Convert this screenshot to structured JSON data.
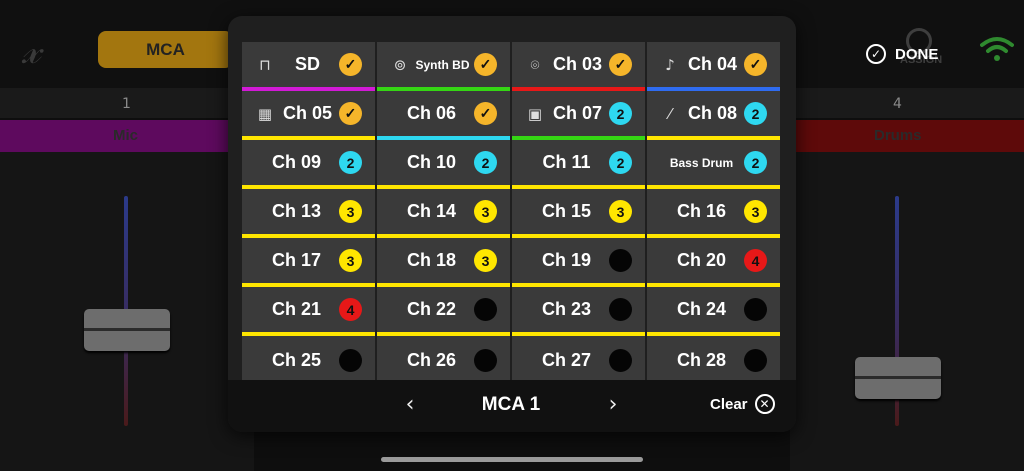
{
  "colors": {
    "yellow": "#ffe600",
    "orange": "#f5b52a",
    "cyan": "#2ed8f0",
    "red": "#e71818",
    "magenta": "#d21ad6",
    "green": "#35d614",
    "blue": "#2f6cf0",
    "empty": "#050505"
  },
  "header": {
    "app_logo": "x-logo",
    "mca_button_label": "MCA",
    "assign_label": "ASSIGN",
    "done_label": "DONE"
  },
  "mixer": {
    "strip_numbers": [
      "1",
      "4"
    ],
    "strip_names": [
      "Mic",
      "Drums"
    ]
  },
  "modal": {
    "title": "MCA 1",
    "prev_icon": "chevron-left-icon",
    "next_icon": "chevron-right-icon",
    "clear_label": "Clear",
    "channels": [
      {
        "label": "SD",
        "icon": "snare-icon",
        "badge": "check",
        "color": "orange",
        "underline": "magenta"
      },
      {
        "label": "Synth BD",
        "icon": "kick-drum-icon",
        "badge": "check",
        "color": "orange",
        "underline": "green"
      },
      {
        "label": "Ch 03",
        "icon": "cymbal-icon",
        "badge": "check",
        "color": "orange",
        "underline": "red"
      },
      {
        "label": "Ch 04",
        "icon": "guitar-icon",
        "badge": "check",
        "color": "orange",
        "underline": "blue"
      },
      {
        "label": "Ch 05",
        "icon": "keyboard-icon",
        "badge": "check",
        "color": "orange",
        "underline": "yellow"
      },
      {
        "label": "Ch 06",
        "icon": "",
        "badge": "check",
        "color": "orange",
        "underline": "cyan"
      },
      {
        "label": "Ch 07",
        "icon": "amp-icon",
        "badge": "2",
        "color": "cyan",
        "underline": "green"
      },
      {
        "label": "Ch 08",
        "icon": "electric-guitar-icon",
        "badge": "2",
        "color": "cyan",
        "underline": "yellow"
      },
      {
        "label": "Ch 09",
        "icon": "",
        "badge": "2",
        "color": "cyan",
        "underline": "yellow"
      },
      {
        "label": "Ch 10",
        "icon": "",
        "badge": "2",
        "color": "cyan",
        "underline": "yellow"
      },
      {
        "label": "Ch 11",
        "icon": "",
        "badge": "2",
        "color": "cyan",
        "underline": "yellow"
      },
      {
        "label": "Bass Drum",
        "icon": "",
        "badge": "2",
        "color": "cyan",
        "underline": "yellow"
      },
      {
        "label": "Ch 13",
        "icon": "",
        "badge": "3",
        "color": "yellow",
        "underline": "yellow"
      },
      {
        "label": "Ch 14",
        "icon": "",
        "badge": "3",
        "color": "yellow",
        "underline": "yellow"
      },
      {
        "label": "Ch 15",
        "icon": "",
        "badge": "3",
        "color": "yellow",
        "underline": "yellow"
      },
      {
        "label": "Ch 16",
        "icon": "",
        "badge": "3",
        "color": "yellow",
        "underline": "yellow"
      },
      {
        "label": "Ch 17",
        "icon": "",
        "badge": "3",
        "color": "yellow",
        "underline": "yellow"
      },
      {
        "label": "Ch 18",
        "icon": "",
        "badge": "3",
        "color": "yellow",
        "underline": "yellow"
      },
      {
        "label": "Ch 19",
        "icon": "",
        "badge": "",
        "color": "empty",
        "underline": "yellow"
      },
      {
        "label": "Ch 20",
        "icon": "",
        "badge": "4",
        "color": "red",
        "underline": "yellow"
      },
      {
        "label": "Ch 21",
        "icon": "",
        "badge": "4",
        "color": "red",
        "underline": "yellow"
      },
      {
        "label": "Ch 22",
        "icon": "",
        "badge": "",
        "color": "empty",
        "underline": "yellow"
      },
      {
        "label": "Ch 23",
        "icon": "",
        "badge": "",
        "color": "empty",
        "underline": "yellow"
      },
      {
        "label": "Ch 24",
        "icon": "",
        "badge": "",
        "color": "empty",
        "underline": "yellow"
      },
      {
        "label": "Ch 25",
        "icon": "",
        "badge": "",
        "color": "empty",
        "underline": "none"
      },
      {
        "label": "Ch 26",
        "icon": "",
        "badge": "",
        "color": "empty",
        "underline": "none"
      },
      {
        "label": "Ch 27",
        "icon": "",
        "badge": "",
        "color": "empty",
        "underline": "none"
      },
      {
        "label": "Ch 28",
        "icon": "",
        "badge": "",
        "color": "empty",
        "underline": "none"
      }
    ]
  }
}
